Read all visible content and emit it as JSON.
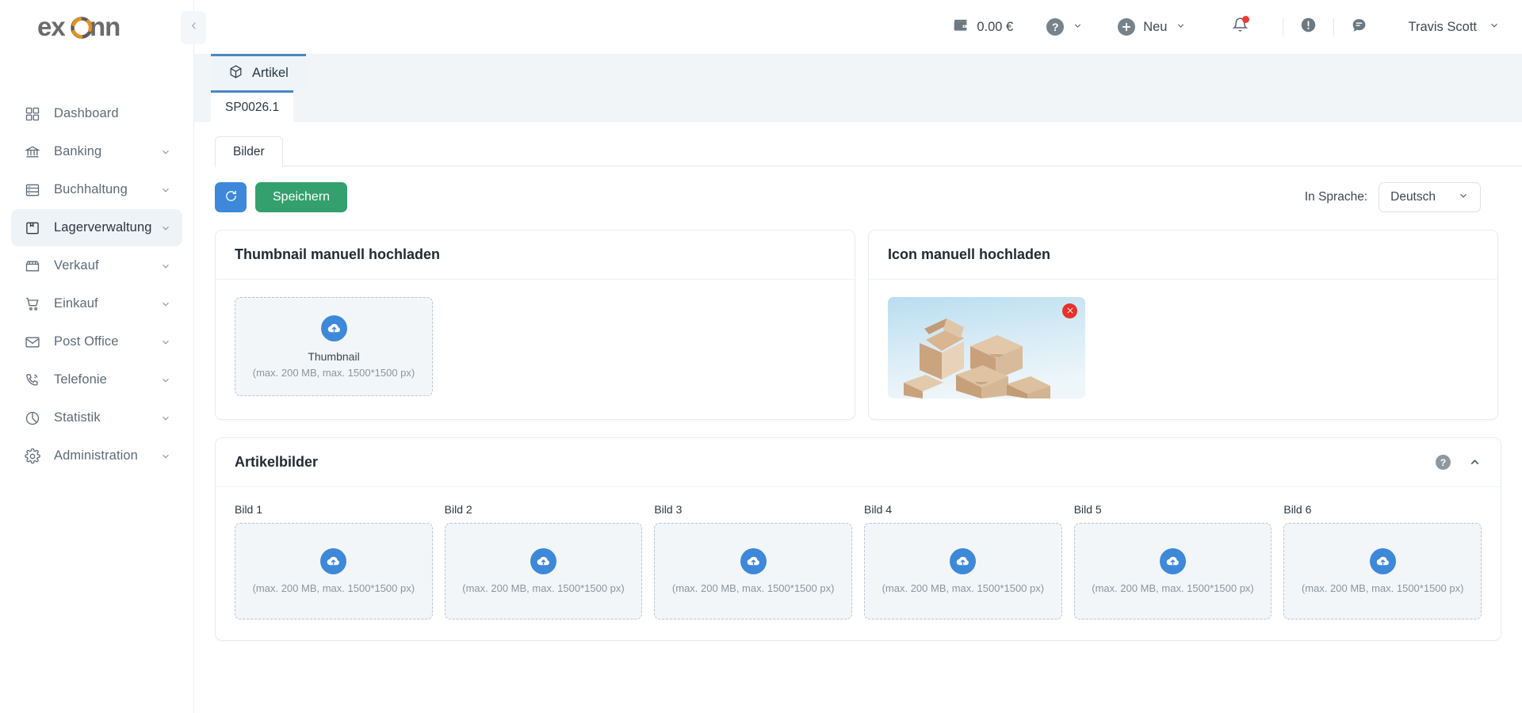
{
  "brand": {
    "name": "exonn",
    "logo_icon": "exonn-swirl-logo"
  },
  "sidebar": {
    "collapse_icon": "chevron-left-icon",
    "items": [
      {
        "label": "Dashboard",
        "icon": "grid-icon",
        "expandable": false,
        "active": false
      },
      {
        "label": "Banking",
        "icon": "bank-icon",
        "expandable": true,
        "active": false
      },
      {
        "label": "Buchhaltung",
        "icon": "ledger-icon",
        "expandable": true,
        "active": false
      },
      {
        "label": "Lagerverwaltung",
        "icon": "box-icon",
        "expandable": true,
        "active": true
      },
      {
        "label": "Verkauf",
        "icon": "store-icon",
        "expandable": true,
        "active": false
      },
      {
        "label": "Einkauf",
        "icon": "cart-icon",
        "expandable": true,
        "active": false
      },
      {
        "label": "Post Office",
        "icon": "envelope-icon",
        "expandable": true,
        "active": false
      },
      {
        "label": "Telefonie",
        "icon": "phone-icon",
        "expandable": true,
        "active": false
      },
      {
        "label": "Statistik",
        "icon": "pie-chart-icon",
        "expandable": true,
        "active": false
      },
      {
        "label": "Administration",
        "icon": "gear-icon",
        "expandable": true,
        "active": false
      }
    ]
  },
  "topbar": {
    "wallet_icon": "wallet-icon",
    "balance": "0.00 €",
    "help_icon": "question-circle-icon",
    "new_icon": "plus-circle-icon",
    "new_label": "Neu",
    "bell_icon": "bell-icon",
    "bell_has_badge": true,
    "alert_icon": "exclamation-circle-icon",
    "chat_icon": "chat-bubble-icon",
    "user_name": "Travis Scott",
    "user_chevron_icon": "chevron-down-icon"
  },
  "tabs": {
    "main": {
      "label": "Artikel",
      "icon": "cube-icon"
    },
    "record": {
      "label": "SP0026.1"
    },
    "inner": {
      "label": "Bilder"
    }
  },
  "toolbar": {
    "refresh_icon": "refresh-icon",
    "save_label": "Speichern",
    "language_label": "In Sprache:",
    "language_value": "Deutsch",
    "language_chevron_icon": "chevron-down-icon"
  },
  "thumbnail_card": {
    "title": "Thumbnail manuell hochladen",
    "dropzone": {
      "icon": "cloud-upload-icon",
      "title": "Thumbnail",
      "hint": "(max. 200 MB, max. 1500*1500 px)"
    }
  },
  "icon_card": {
    "title": "Icon manuell hochladen",
    "preview_alt": "cardboard-boxes-photo",
    "delete_icon": "close-circle-icon"
  },
  "article_images": {
    "title": "Artikelbilder",
    "help_icon": "question-circle-icon",
    "collapse_icon": "chevron-up-icon",
    "upload_icon": "cloud-upload-icon",
    "hint": "(max. 200 MB, max. 1500*1500 px)",
    "cells": [
      {
        "label": "Bild 1"
      },
      {
        "label": "Bild 2"
      },
      {
        "label": "Bild 3"
      },
      {
        "label": "Bild 4"
      },
      {
        "label": "Bild 5"
      },
      {
        "label": "Bild 6"
      }
    ]
  },
  "colors": {
    "accent_blue": "#3d88d8",
    "save_green": "#34a06e",
    "delete_red": "#e8312a",
    "tab_blue": "#4a86c5",
    "logo_orange": "#e8911c",
    "logo_gray": "#6b6b6b",
    "page_bg": "#eef2f5"
  }
}
